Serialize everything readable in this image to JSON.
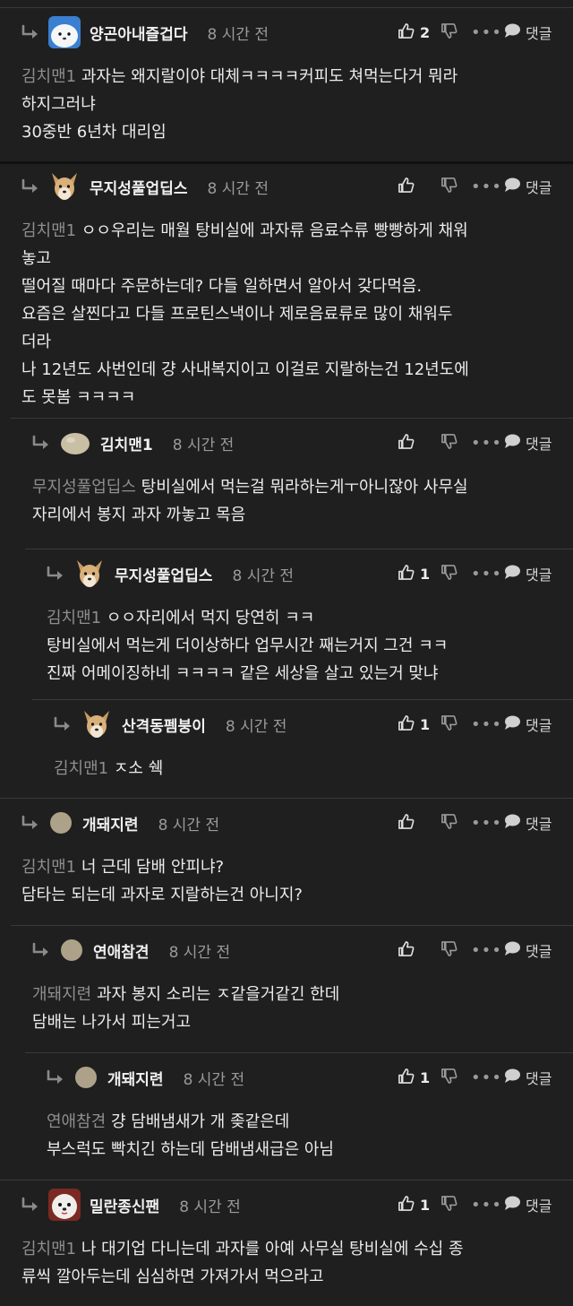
{
  "time_label": "8 시간 전",
  "reply_label": "댓글",
  "more_label": "•••",
  "comments": [
    {
      "author": "양곤아내즐겁다",
      "likes": "2",
      "mention": "김치맨1",
      "lines": [
        "과자는 왜지랄이야 대체ㅋㅋㅋㅋ커피도 쳐먹는다거 뭐라",
        "하지그러냐",
        "30중반 6년차 대리임"
      ]
    },
    {
      "author": "무지성풀업딥스",
      "likes": "",
      "mention": "김치맨1",
      "lines": [
        "ㅇㅇ우리는 매월 탕비실에 과자류 음료수류 빵빵하게 채워",
        "놓고",
        "떨어질 때마다 주문하는데? 다들 일하면서 알아서 갖다먹음.",
        "요즘은 살찐다고 다들 프로틴스낵이나 제로음료류로 많이 채워두",
        "더라",
        "나 12년도 사번인데 걍 사내복지이고 이걸로 지랄하는건 12년도에",
        "도 못봄 ㅋㅋㅋㅋ"
      ]
    },
    {
      "author": "김치맨1",
      "likes": "",
      "mention": "무지성풀업딥스",
      "lines": [
        "탕비실에서 먹는걸 뭐라하는게ㅜ아니잖아 사무실",
        "자리에서 봉지 과자 까놓고 목음"
      ]
    },
    {
      "author": "무지성풀업딥스",
      "likes": "1",
      "mention": "김치맨1",
      "lines": [
        "ㅇㅇ자리에서 먹지 당연히 ㅋㅋ",
        "탕비실에서 먹는게 더이상하다 업무시간 째는거지 그건 ㅋㅋ",
        "진짜 어메이징하네 ㅋㅋㅋㅋ 같은 세상을 살고 있는거 맞냐"
      ]
    },
    {
      "author": "산격동펨붕이",
      "likes": "1",
      "mention": "김치맨1",
      "lines": [
        "ㅈ소 쉑"
      ]
    },
    {
      "author": "개돼지련",
      "likes": "",
      "mention": "김치맨1",
      "lines": [
        "너 근데 담배 안피냐?",
        "담타는 되는데 과자로 지랄하는건 아니지?"
      ]
    },
    {
      "author": "연애참견",
      "likes": "",
      "mention": "개돼지련",
      "lines": [
        "과자 봉지 소리는 ㅈ같을거같긴 한데",
        "담배는 나가서 피는거고"
      ]
    },
    {
      "author": "개돼지련",
      "likes": "1",
      "mention": "연애참견",
      "lines": [
        "걍 담배냄새가 개 좆같은데",
        "부스럭도 빡치긴 하는데 담배냄새급은 아님"
      ]
    },
    {
      "author": "밀란종신팬",
      "likes": "1",
      "mention": "김치맨1",
      "lines": [
        "나 대기업 다니는데 과자를 아예 사무실 탕비실에 수십 종",
        "류씩 깔아두는데 심심하면 가져가서 먹으라고"
      ]
    }
  ]
}
